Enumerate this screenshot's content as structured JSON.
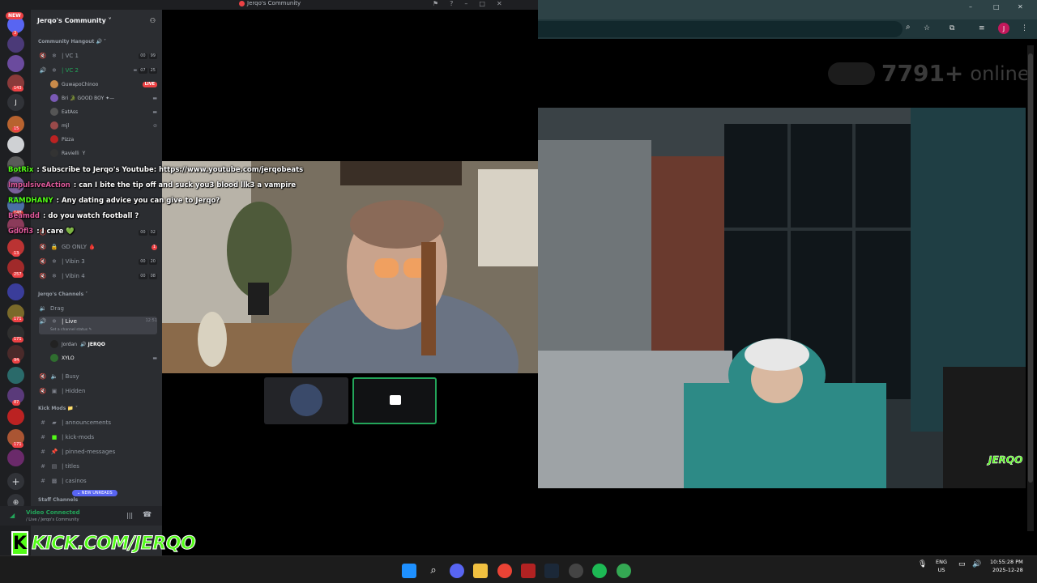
{
  "discord": {
    "window_title": "Jerqo's Community",
    "new_badge": "NEW",
    "guild_name": "Jerqo's Community ˅",
    "categories": {
      "community_hangout": "Community Hangout 🔊 ˅",
      "jerqos_channels": "Jerqo's Channels ˅",
      "kick_mods": "Kick Mods 📁 ˅",
      "staff_channels": "Staff Channels"
    },
    "channels": {
      "vc1": {
        "name": "| VC 1",
        "count_a": "00",
        "count_b": "99"
      },
      "vc2": {
        "name": "| VC 2",
        "count_a": "07",
        "count_b": "25"
      },
      "gd_only": {
        "name": "GD ONLY 🩸",
        "badge": "1"
      },
      "vibin3": {
        "name": "| Vibin 3",
        "count_a": "00",
        "count_b": "20"
      },
      "vibin4": {
        "name": "| Vibin 4",
        "count_a": "00",
        "count_b": "08"
      },
      "chill": {
        "count_a": "00",
        "count_b": "02"
      },
      "drag": {
        "name": "Drag"
      },
      "live": {
        "name": "| Live",
        "time": "12:51",
        "status": "Set a channel status ✎"
      },
      "busy": {
        "name": "| Busy"
      },
      "hidden": {
        "name": "| Hidden"
      },
      "announcements": {
        "name": "| announcements"
      },
      "kick_mods": {
        "name": "| kick-mods"
      },
      "pinned": {
        "name": "| pinned-messages"
      },
      "titles": {
        "name": "| titles"
      },
      "casinos": {
        "name": "| casinos"
      }
    },
    "vc2_users": [
      {
        "name": "GuwapoChinoo",
        "live": "LIVE"
      },
      {
        "name": "Bri 🐊 GOOD BOY ✦—"
      },
      {
        "name": "EatAss"
      },
      {
        "name": "mjl"
      },
      {
        "name": "Pizza"
      },
      {
        "name": "Ravielli",
        "extra": "Y"
      }
    ],
    "live_users": [
      {
        "name": "Jordan",
        "tag": "🔊 JERQO"
      },
      {
        "name": "XYLO"
      }
    ],
    "new_unreads": "⌄ NEW UNREADS",
    "voice": {
      "status": "Video Connected",
      "location": "/ Live / Jerqo's Community"
    },
    "server_badges": [
      "3",
      "143",
      "15",
      "148",
      "13",
      "257",
      "171",
      "171",
      "94",
      "87",
      "171"
    ]
  },
  "chat_overlay": [
    {
      "user": "BotRix",
      "text": ": Subscribe to Jerqo's Youtube: https://www.youtube.com/jerqobeats",
      "color": "#53fc18"
    },
    {
      "user": "ImpulsiveAction",
      "text": ": can I bite the tip off and suck you3 blood llk3 a vampire",
      "color": "#e05a9c"
    },
    {
      "user": "RAMDHANY",
      "text": ": Any dating advice you can give to Jerqo?",
      "color": "#53fc18"
    },
    {
      "user": "Beamdd",
      "text": ": do you watch football ?",
      "color": "#e05a9c"
    },
    {
      "user": "Gd0fl3",
      "text": ": I care 💚",
      "color": "#e05a9c"
    }
  ],
  "kick_brand": {
    "k": "K",
    "text": "KICK.COM/JERQO"
  },
  "browser": {
    "online_count": "7791+",
    "online_label": "online",
    "avatar_letter": "J",
    "overlay_brand": "JERQO"
  },
  "taskbar": {
    "lang_line1": "ENG",
    "lang_line2": "US",
    "time": "10:55:28 PM",
    "date": "2025-12-28"
  },
  "colors": {
    "discord_bg": "#2b2d31",
    "discord_rail": "#1e1f22",
    "accent_green": "#23a55a",
    "kick_green": "#53fc18",
    "live_red": "#ed4245",
    "browser_teal": "#2d4246"
  }
}
